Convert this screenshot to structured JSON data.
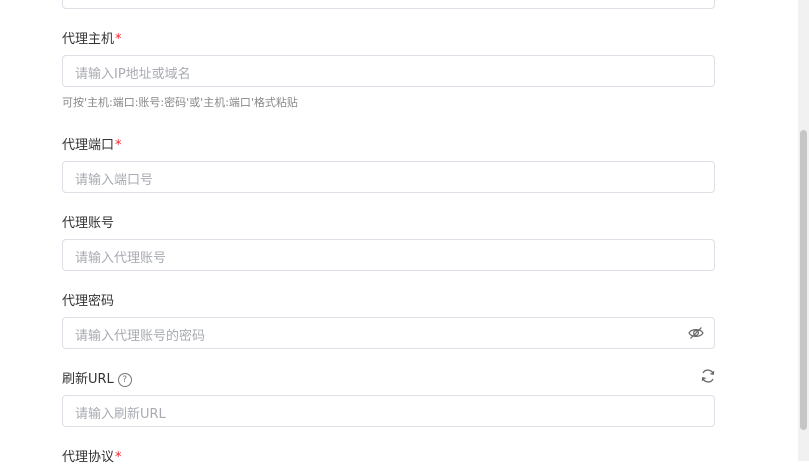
{
  "fields": {
    "proxy_host": {
      "label": "代理主机",
      "required": "*",
      "placeholder": "请输入IP地址或域名",
      "hint": "可按'主机:端口:账号:密码'或'主机:端口'格式粘贴"
    },
    "proxy_port": {
      "label": "代理端口",
      "required": "*",
      "placeholder": "请输入端口号"
    },
    "proxy_account": {
      "label": "代理账号",
      "placeholder": "请输入代理账号"
    },
    "proxy_password": {
      "label": "代理密码",
      "placeholder": "请输入代理账号的密码",
      "icon": "eye-slash-icon"
    },
    "refresh_url": {
      "label": "刷新URL",
      "help_glyph": "?",
      "placeholder": "请输入刷新URL",
      "icon": "refresh-icon"
    },
    "proxy_protocol": {
      "label": "代理协议",
      "required": "*"
    }
  },
  "colors": {
    "required": "#f5222d",
    "border": "#dcdfe6",
    "placeholder": "#a8abb2"
  }
}
